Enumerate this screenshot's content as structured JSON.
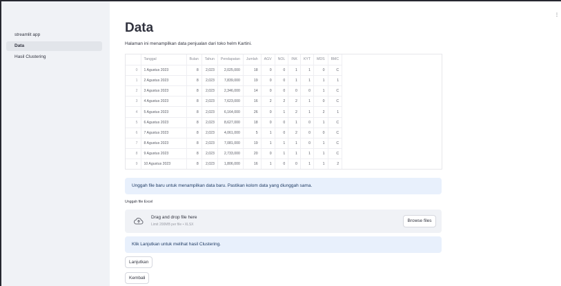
{
  "sidebar": {
    "items": [
      {
        "label": "streamlit app",
        "active": false
      },
      {
        "label": "Data",
        "active": true
      },
      {
        "label": "Hasil Clustering",
        "active": false
      }
    ]
  },
  "page": {
    "title": "Data",
    "subtitle": "Halaman ini menampilkan data penjualan dari toko helm Kartini.",
    "corner_mark": "⋮"
  },
  "table": {
    "columns": [
      "",
      "Tanggal",
      "Bulan",
      "Tahun",
      "Pendapatan",
      "Jumlah",
      "AGV",
      "NOL",
      "INK",
      "KYT",
      "MDS",
      "BMC"
    ],
    "rows": [
      [
        "0",
        "1 Agustus 2023",
        "8",
        "2,023",
        "2,025,000",
        "18",
        "0",
        "0",
        "1",
        "1",
        "0",
        "C"
      ],
      [
        "1",
        "2 Agustus 2023",
        "8",
        "2,023",
        "7,839,000",
        "19",
        "0",
        "0",
        "1",
        "1",
        "1",
        "1"
      ],
      [
        "2",
        "3 Agustus 2023",
        "8",
        "2,023",
        "2,346,000",
        "14",
        "0",
        "0",
        "0",
        "0",
        "1",
        "C"
      ],
      [
        "3",
        "4 Agustus 2023",
        "8",
        "2,023",
        "7,623,000",
        "16",
        "2",
        "2",
        "2",
        "1",
        "0",
        "C"
      ],
      [
        "4",
        "5 Agustus 2023",
        "8",
        "2,023",
        "6,164,000",
        "26",
        "0",
        "1",
        "2",
        "1",
        "2",
        "1"
      ],
      [
        "5",
        "6 Agustus 2023",
        "8",
        "2,023",
        "8,627,000",
        "18",
        "0",
        "0",
        "1",
        "0",
        "1",
        "C"
      ],
      [
        "6",
        "7 Agustus 2023",
        "8",
        "2,023",
        "4,061,000",
        "5",
        "1",
        "0",
        "2",
        "0",
        "0",
        "C"
      ],
      [
        "7",
        "8 Agustus 2023",
        "8",
        "2,023",
        "7,081,000",
        "19",
        "1",
        "1",
        "1",
        "0",
        "1",
        "C"
      ],
      [
        "8",
        "9 Agustus 2023",
        "8",
        "2,023",
        "2,733,000",
        "20",
        "0",
        "1",
        "1",
        "1",
        "1",
        "C"
      ],
      [
        "9",
        "10 Agustus 2023",
        "8",
        "2,023",
        "1,806,000",
        "16",
        "1",
        "0",
        "0",
        "1",
        "1",
        "2"
      ]
    ]
  },
  "info_upload": "Unggah file baru untuk menampilkan data baru. Pastikan kolom data yang diunggah sama.",
  "uploader": {
    "label": "Unggah file Excel",
    "drop_title": "Drag and drop file here",
    "drop_limit": "Limit 200MB per file • XLSX",
    "browse_label": "Browse files",
    "icon": "upload-cloud-icon"
  },
  "info_next": "Klik Lanjutkan untuk melihat hasil Clustering.",
  "buttons": {
    "next": "Lanjutkan",
    "back": "Kembali"
  }
}
